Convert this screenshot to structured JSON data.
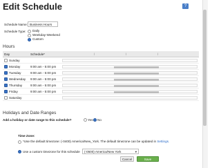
{
  "page": {
    "title": "Edit Schedule",
    "help_icon": "?"
  },
  "form": {
    "name_label": "Schedule Name:",
    "name_value": "Business Hours",
    "type_label": "Schedule Type:",
    "type_options": [
      {
        "label": "Daily",
        "selected": false
      },
      {
        "label": "Weekday-Weekend",
        "selected": false
      },
      {
        "label": "Custom",
        "selected": true
      }
    ]
  },
  "hours": {
    "section_title": "Hours",
    "col_day": "Day",
    "col_schedule": "Schedule*",
    "rows": [
      {
        "day": "Sunday",
        "checked": false,
        "time": ""
      },
      {
        "day": "Monday",
        "checked": true,
        "time": "9:00 am - 5:00 pm"
      },
      {
        "day": "Tuesday",
        "checked": true,
        "time": "9:00 am - 5:00 pm"
      },
      {
        "day": "Wednesday",
        "checked": true,
        "time": "9:00 am - 5:00 pm"
      },
      {
        "day": "Thursday",
        "checked": true,
        "time": "9:00 am - 5:00 pm"
      },
      {
        "day": "Friday",
        "checked": true,
        "time": "9:00 am - 5:00 pm"
      },
      {
        "day": "Saturday",
        "checked": false,
        "time": ""
      }
    ]
  },
  "holidays": {
    "section_title": "Holidays and Date Ranges",
    "question": "Add a holiday or date range to this schedule?",
    "yes_label": "Yes",
    "no_label": "No",
    "selected": "No"
  },
  "timezone": {
    "label": "Time Zone:",
    "default_text": "*Use the default timezone: (-0400) America/New_York. The default timezone can be updated in",
    "settings_link": "Settings.",
    "custom_label": "Use a custom timezone for this schedule",
    "custom_selected": true,
    "custom_value": "(-0500) America/New York"
  },
  "actions": {
    "cancel_label": "Cancel",
    "save_label": "Save Changes"
  },
  "colors": {
    "accent": "#3a73c6",
    "save": "#6ab04c",
    "link": "#2a6bc9"
  }
}
